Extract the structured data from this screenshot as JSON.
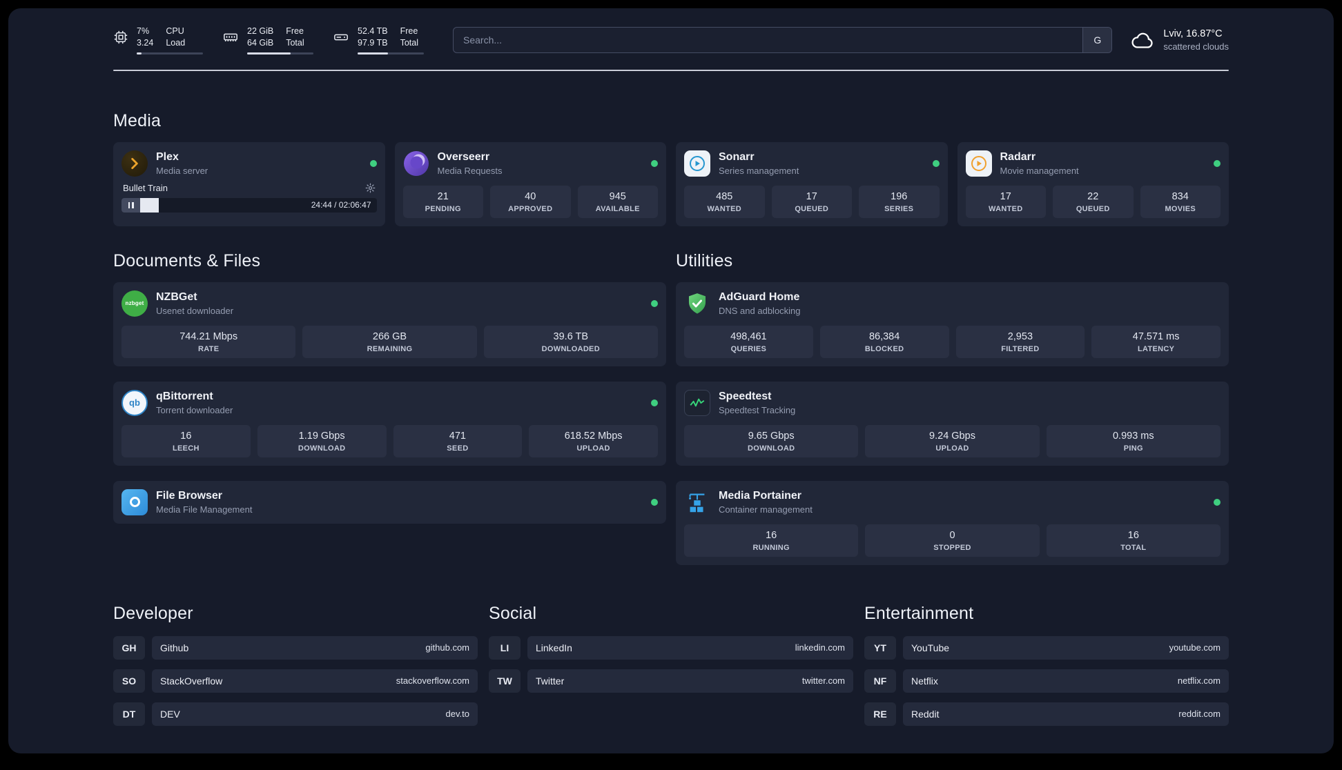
{
  "colors": {
    "background": "#161b2a",
    "card": "#212738",
    "stat_tile": "#2a3043",
    "status_online": "#3fcf80",
    "adguard_green": "#3fae46",
    "portainer_blue": "#35a3e8"
  },
  "header": {
    "cpu": {
      "value_top": "7%",
      "value_bottom": "3.24",
      "label_top": "CPU",
      "label_bottom": "Load",
      "bar_percent": 7
    },
    "ram": {
      "value_top": "22 GiB",
      "value_bottom": "64 GiB",
      "label_top": "Free",
      "label_bottom": "Total",
      "bar_percent": 66
    },
    "disk": {
      "value_top": "52.4 TB",
      "value_bottom": "97.9 TB",
      "label_top": "Free",
      "label_bottom": "Total",
      "bar_percent": 46
    },
    "search": {
      "placeholder": "Search...",
      "engine_button": "G"
    },
    "weather": {
      "location": "Lviv, 16.87°C",
      "condition": "scattered clouds"
    }
  },
  "sections": {
    "media": "Media",
    "documents": "Documents & Files",
    "utilities": "Utilities",
    "developer": "Developer",
    "social": "Social",
    "entertainment": "Entertainment"
  },
  "apps": {
    "plex": {
      "name": "Plex",
      "description": "Media server",
      "status": "online",
      "player": {
        "track": "Bullet Train",
        "time": "24:44 / 02:06:47",
        "progress_percent": 8
      }
    },
    "overseerr": {
      "name": "Overseerr",
      "description": "Media Requests",
      "status": "online",
      "stats": [
        {
          "value": "21",
          "label": "PENDING"
        },
        {
          "value": "40",
          "label": "APPROVED"
        },
        {
          "value": "945",
          "label": "AVAILABLE"
        }
      ]
    },
    "sonarr": {
      "name": "Sonarr",
      "description": "Series management",
      "status": "online",
      "stats": [
        {
          "value": "485",
          "label": "WANTED"
        },
        {
          "value": "17",
          "label": "QUEUED"
        },
        {
          "value": "196",
          "label": "SERIES"
        }
      ]
    },
    "radarr": {
      "name": "Radarr",
      "description": "Movie management",
      "status": "online",
      "stats": [
        {
          "value": "17",
          "label": "WANTED"
        },
        {
          "value": "22",
          "label": "QUEUED"
        },
        {
          "value": "834",
          "label": "MOVIES"
        }
      ]
    },
    "nzbget": {
      "name": "NZBGet",
      "description": "Usenet downloader",
      "status": "online",
      "stats": [
        {
          "value": "744.21 Mbps",
          "label": "RATE"
        },
        {
          "value": "266 GB",
          "label": "REMAINING"
        },
        {
          "value": "39.6 TB",
          "label": "DOWNLOADED"
        }
      ]
    },
    "qbittorrent": {
      "name": "qBittorrent",
      "description": "Torrent downloader",
      "status": "online",
      "stats": [
        {
          "value": "16",
          "label": "LEECH"
        },
        {
          "value": "1.19 Gbps",
          "label": "DOWNLOAD"
        },
        {
          "value": "471",
          "label": "SEED"
        },
        {
          "value": "618.52 Mbps",
          "label": "UPLOAD"
        }
      ]
    },
    "filebrowser": {
      "name": "File Browser",
      "description": "Media File Management",
      "status": "online"
    },
    "adguard": {
      "name": "AdGuard Home",
      "description": "DNS and adblocking",
      "stats": [
        {
          "value": "498,461",
          "label": "QUERIES"
        },
        {
          "value": "86,384",
          "label": "BLOCKED"
        },
        {
          "value": "2,953",
          "label": "FILTERED"
        },
        {
          "value": "47.571 ms",
          "label": "LATENCY"
        }
      ]
    },
    "speedtest": {
      "name": "Speedtest",
      "description": "Speedtest Tracking",
      "stats": [
        {
          "value": "9.65 Gbps",
          "label": "DOWNLOAD"
        },
        {
          "value": "9.24 Gbps",
          "label": "UPLOAD"
        },
        {
          "value": "0.993 ms",
          "label": "PING"
        }
      ]
    },
    "portainer": {
      "name": "Media Portainer",
      "description": "Container management",
      "status": "online",
      "stats": [
        {
          "value": "16",
          "label": "RUNNING"
        },
        {
          "value": "0",
          "label": "STOPPED"
        },
        {
          "value": "16",
          "label": "TOTAL"
        }
      ]
    }
  },
  "links": {
    "developer": [
      {
        "abbr": "GH",
        "name": "Github",
        "url": "github.com"
      },
      {
        "abbr": "SO",
        "name": "StackOverflow",
        "url": "stackoverflow.com"
      },
      {
        "abbr": "DT",
        "name": "DEV",
        "url": "dev.to"
      }
    ],
    "social": [
      {
        "abbr": "LI",
        "name": "LinkedIn",
        "url": "linkedin.com"
      },
      {
        "abbr": "TW",
        "name": "Twitter",
        "url": "twitter.com"
      }
    ],
    "entertainment": [
      {
        "abbr": "YT",
        "name": "YouTube",
        "url": "youtube.com"
      },
      {
        "abbr": "NF",
        "name": "Netflix",
        "url": "netflix.com"
      },
      {
        "abbr": "RE",
        "name": "Reddit",
        "url": "reddit.com"
      }
    ]
  }
}
